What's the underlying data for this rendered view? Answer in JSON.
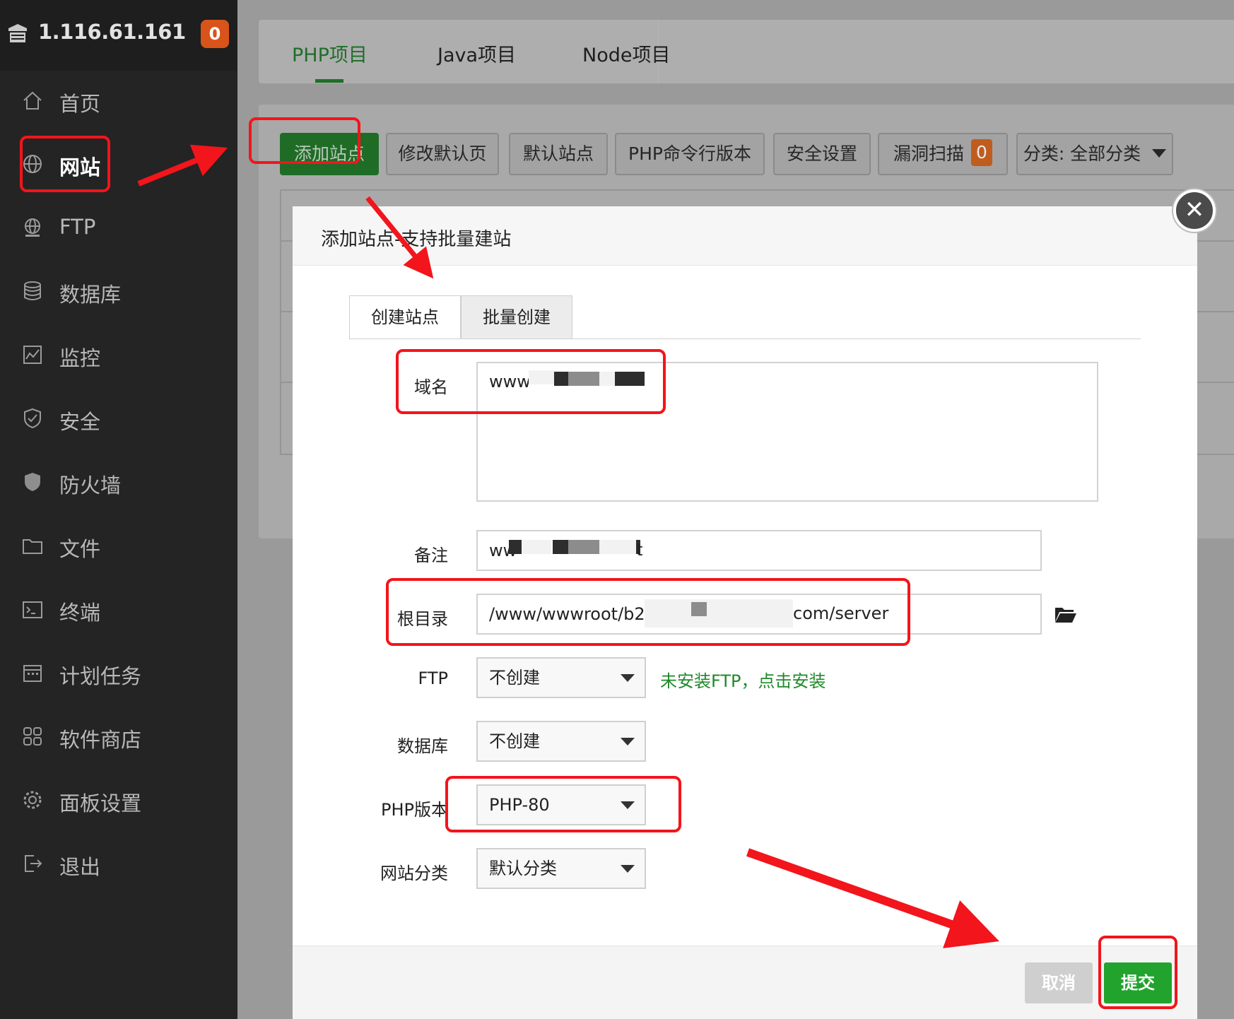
{
  "sidebar": {
    "ip": "1.116.61.161",
    "badge": "0",
    "items": [
      {
        "label": "首页",
        "icon": "home-icon"
      },
      {
        "label": "网站",
        "icon": "globe-icon",
        "active": true
      },
      {
        "label": "FTP",
        "icon": "ftp-globe-icon"
      },
      {
        "label": "数据库",
        "icon": "database-icon"
      },
      {
        "label": "监控",
        "icon": "monitor-chart-icon"
      },
      {
        "label": "安全",
        "icon": "shield-check-icon"
      },
      {
        "label": "防火墙",
        "icon": "firewall-shield-icon"
      },
      {
        "label": "文件",
        "icon": "folder-icon"
      },
      {
        "label": "终端",
        "icon": "terminal-icon"
      },
      {
        "label": "计划任务",
        "icon": "calendar-icon"
      },
      {
        "label": "软件商店",
        "icon": "grid-apps-icon"
      },
      {
        "label": "面板设置",
        "icon": "gear-icon"
      },
      {
        "label": "退出",
        "icon": "logout-icon"
      }
    ]
  },
  "project_tabs": [
    "PHP项目",
    "Java项目",
    "Node项目"
  ],
  "toolbar": {
    "add_site": "添加站点",
    "edit_default_page": "修改默认页",
    "default_site": "默认站点",
    "php_cli_version": "PHP命令行版本",
    "security_settings": "安全设置",
    "vuln_scan": "漏洞扫描",
    "vuln_scan_count": "0",
    "category": "分类: 全部分类"
  },
  "modal": {
    "title": "添加站点-支持批量建站",
    "tabs": [
      "创建站点",
      "批量创建"
    ],
    "fields": {
      "domain_label": "域名",
      "domain_value": "www",
      "remark_label": "备注",
      "remark_value": "ww",
      "remark_suffix": "t",
      "root_label": "根目录",
      "root_prefix": "/www/wwwroot/b2",
      "root_suffix": "com/server",
      "ftp_label": "FTP",
      "ftp_value": "不创建",
      "ftp_hint": "未安装FTP，点击安装",
      "db_label": "数据库",
      "db_value": "不创建",
      "php_label": "PHP版本",
      "php_value": "PHP-80",
      "category_label": "网站分类",
      "category_value": "默认分类"
    },
    "cancel": "取消",
    "submit": "提交"
  },
  "colors": {
    "sidebar_bg": "#242424",
    "accent_green": "#20a32e",
    "annotation_red": "#f2151b",
    "badge_orange": "#d9541a"
  }
}
